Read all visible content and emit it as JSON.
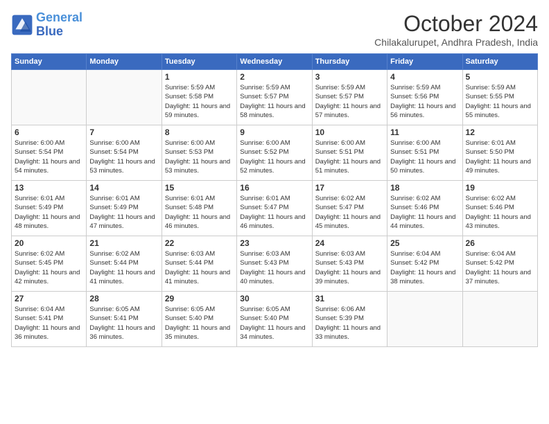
{
  "logo": {
    "line1": "General",
    "line2": "Blue"
  },
  "title": "October 2024",
  "subtitle": "Chilakalurupet, Andhra Pradesh, India",
  "days_of_week": [
    "Sunday",
    "Monday",
    "Tuesday",
    "Wednesday",
    "Thursday",
    "Friday",
    "Saturday"
  ],
  "weeks": [
    [
      {
        "day": "",
        "info": ""
      },
      {
        "day": "",
        "info": ""
      },
      {
        "day": "1",
        "info": "Sunrise: 5:59 AM\nSunset: 5:58 PM\nDaylight: 11 hours and 59 minutes."
      },
      {
        "day": "2",
        "info": "Sunrise: 5:59 AM\nSunset: 5:57 PM\nDaylight: 11 hours and 58 minutes."
      },
      {
        "day": "3",
        "info": "Sunrise: 5:59 AM\nSunset: 5:57 PM\nDaylight: 11 hours and 57 minutes."
      },
      {
        "day": "4",
        "info": "Sunrise: 5:59 AM\nSunset: 5:56 PM\nDaylight: 11 hours and 56 minutes."
      },
      {
        "day": "5",
        "info": "Sunrise: 5:59 AM\nSunset: 5:55 PM\nDaylight: 11 hours and 55 minutes."
      }
    ],
    [
      {
        "day": "6",
        "info": "Sunrise: 6:00 AM\nSunset: 5:54 PM\nDaylight: 11 hours and 54 minutes."
      },
      {
        "day": "7",
        "info": "Sunrise: 6:00 AM\nSunset: 5:54 PM\nDaylight: 11 hours and 53 minutes."
      },
      {
        "day": "8",
        "info": "Sunrise: 6:00 AM\nSunset: 5:53 PM\nDaylight: 11 hours and 53 minutes."
      },
      {
        "day": "9",
        "info": "Sunrise: 6:00 AM\nSunset: 5:52 PM\nDaylight: 11 hours and 52 minutes."
      },
      {
        "day": "10",
        "info": "Sunrise: 6:00 AM\nSunset: 5:51 PM\nDaylight: 11 hours and 51 minutes."
      },
      {
        "day": "11",
        "info": "Sunrise: 6:00 AM\nSunset: 5:51 PM\nDaylight: 11 hours and 50 minutes."
      },
      {
        "day": "12",
        "info": "Sunrise: 6:01 AM\nSunset: 5:50 PM\nDaylight: 11 hours and 49 minutes."
      }
    ],
    [
      {
        "day": "13",
        "info": "Sunrise: 6:01 AM\nSunset: 5:49 PM\nDaylight: 11 hours and 48 minutes."
      },
      {
        "day": "14",
        "info": "Sunrise: 6:01 AM\nSunset: 5:49 PM\nDaylight: 11 hours and 47 minutes."
      },
      {
        "day": "15",
        "info": "Sunrise: 6:01 AM\nSunset: 5:48 PM\nDaylight: 11 hours and 46 minutes."
      },
      {
        "day": "16",
        "info": "Sunrise: 6:01 AM\nSunset: 5:47 PM\nDaylight: 11 hours and 46 minutes."
      },
      {
        "day": "17",
        "info": "Sunrise: 6:02 AM\nSunset: 5:47 PM\nDaylight: 11 hours and 45 minutes."
      },
      {
        "day": "18",
        "info": "Sunrise: 6:02 AM\nSunset: 5:46 PM\nDaylight: 11 hours and 44 minutes."
      },
      {
        "day": "19",
        "info": "Sunrise: 6:02 AM\nSunset: 5:46 PM\nDaylight: 11 hours and 43 minutes."
      }
    ],
    [
      {
        "day": "20",
        "info": "Sunrise: 6:02 AM\nSunset: 5:45 PM\nDaylight: 11 hours and 42 minutes."
      },
      {
        "day": "21",
        "info": "Sunrise: 6:02 AM\nSunset: 5:44 PM\nDaylight: 11 hours and 41 minutes."
      },
      {
        "day": "22",
        "info": "Sunrise: 6:03 AM\nSunset: 5:44 PM\nDaylight: 11 hours and 41 minutes."
      },
      {
        "day": "23",
        "info": "Sunrise: 6:03 AM\nSunset: 5:43 PM\nDaylight: 11 hours and 40 minutes."
      },
      {
        "day": "24",
        "info": "Sunrise: 6:03 AM\nSunset: 5:43 PM\nDaylight: 11 hours and 39 minutes."
      },
      {
        "day": "25",
        "info": "Sunrise: 6:04 AM\nSunset: 5:42 PM\nDaylight: 11 hours and 38 minutes."
      },
      {
        "day": "26",
        "info": "Sunrise: 6:04 AM\nSunset: 5:42 PM\nDaylight: 11 hours and 37 minutes."
      }
    ],
    [
      {
        "day": "27",
        "info": "Sunrise: 6:04 AM\nSunset: 5:41 PM\nDaylight: 11 hours and 36 minutes."
      },
      {
        "day": "28",
        "info": "Sunrise: 6:05 AM\nSunset: 5:41 PM\nDaylight: 11 hours and 36 minutes."
      },
      {
        "day": "29",
        "info": "Sunrise: 6:05 AM\nSunset: 5:40 PM\nDaylight: 11 hours and 35 minutes."
      },
      {
        "day": "30",
        "info": "Sunrise: 6:05 AM\nSunset: 5:40 PM\nDaylight: 11 hours and 34 minutes."
      },
      {
        "day": "31",
        "info": "Sunrise: 6:06 AM\nSunset: 5:39 PM\nDaylight: 11 hours and 33 minutes."
      },
      {
        "day": "",
        "info": ""
      },
      {
        "day": "",
        "info": ""
      }
    ]
  ]
}
